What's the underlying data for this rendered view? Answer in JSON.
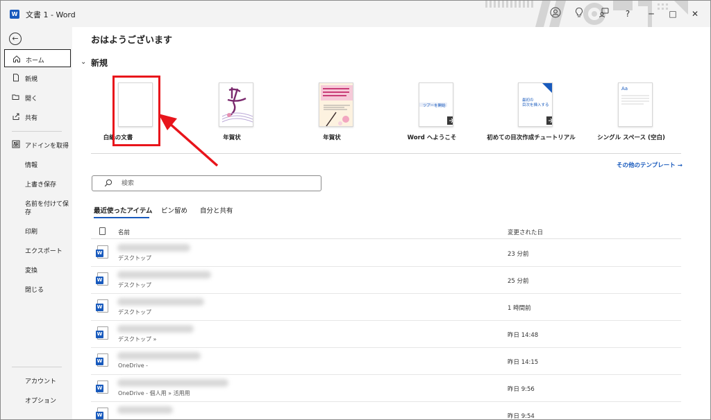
{
  "window": {
    "app_icon_letter": "W",
    "title": "文書 1  -  Word"
  },
  "titlebar_buttons": {
    "account_icon": "person-circle-icon",
    "tips_icon": "lightbulb-icon",
    "feedback_icon": "feedback-icon",
    "help_label": "?",
    "minimize_label": "─",
    "maximize_label": "□",
    "close_label": "✕"
  },
  "sidebar": {
    "back_label": "←",
    "items_top": [
      {
        "label": "ホーム",
        "icon": "⌂",
        "active": true
      },
      {
        "label": "新規",
        "icon": "🗋"
      },
      {
        "label": "開く",
        "icon": "🗁"
      },
      {
        "label": "共有",
        "icon": "⇪"
      }
    ],
    "items_mid": [
      {
        "label": "アドインを取得",
        "icon": "▦"
      },
      {
        "label": "情報"
      },
      {
        "label": "上書き保存"
      },
      {
        "label": "名前を付けて保",
        "label2": "存"
      },
      {
        "label": "印刷"
      },
      {
        "label": "エクスポート"
      },
      {
        "label": "変換"
      },
      {
        "label": "閉じる"
      }
    ],
    "items_bottom": [
      {
        "label": "アカウント"
      },
      {
        "label": "オプション"
      }
    ]
  },
  "main": {
    "greeting": "おはようございます",
    "section_toggle": "⌄",
    "new_section_title": "新規",
    "templates": [
      {
        "label": "白紙の文書"
      },
      {
        "label": "年賀状"
      },
      {
        "label": "年賀状"
      },
      {
        "label": "Word へようこそ",
        "thumb_text": "ツアーを開始"
      },
      {
        "label": "初めての目次作成チュートリアル",
        "thumb_text": "最初の\n目次を挿入する"
      },
      {
        "label": "シングル スペース (空白)",
        "thumb_text": "Aa"
      }
    ],
    "more_templates": "その他のテンプレート →",
    "search_placeholder": "検索",
    "tabs": [
      "最近使ったアイテム",
      "ピン留め",
      "自分と共有"
    ],
    "list_header": {
      "name": "名前",
      "date": "変更された日"
    },
    "files": [
      {
        "location": "デスクトップ",
        "date": "23 分前"
      },
      {
        "location": "デスクトップ",
        "date": "25 分前"
      },
      {
        "location": "デスクトップ",
        "date": "1 時間前"
      },
      {
        "location": "デスクトップ »",
        "date": "昨日 14:48"
      },
      {
        "location": "OneDrive -",
        "date": "昨日 14:15"
      },
      {
        "location": "OneDrive - 個人用 » 活用用",
        "date": "昨日 9:56"
      },
      {
        "location": "",
        "date": "昨日 9:54"
      }
    ]
  },
  "colors": {
    "accent_blue": "#185abd",
    "highlight_red": "#e8141b"
  }
}
